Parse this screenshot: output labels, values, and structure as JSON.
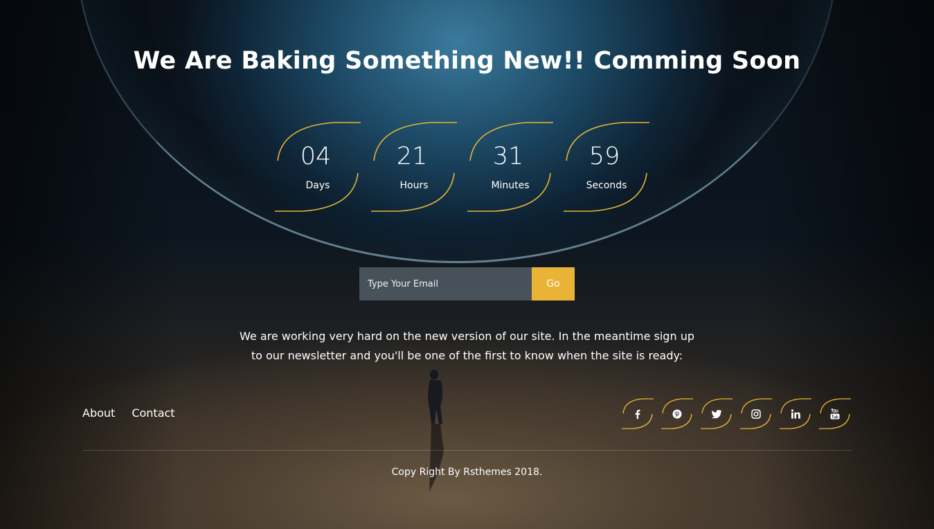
{
  "headline": "We Are Baking Something New!! Comming Soon",
  "countdown": [
    {
      "value": "04",
      "label": "Days"
    },
    {
      "value": "21",
      "label": "Hours"
    },
    {
      "value": "31",
      "label": "Minutes"
    },
    {
      "value": "59",
      "label": "Seconds"
    }
  ],
  "subscribe": {
    "placeholder": "Type Your Email",
    "button_label": "Go"
  },
  "description": "We are working very hard on the new version of our site. In the meantime sign up to our newsletter and you'll be one of the first to know when the site is ready:",
  "footer": {
    "links": [
      "About",
      "Contact"
    ],
    "social_icons": [
      "facebook-icon",
      "pinterest-icon",
      "twitter-icon",
      "instagram-icon",
      "linkedin-icon",
      "youtube-icon"
    ],
    "copyright": "Copy Right By Rsthemes 2018."
  },
  "colors": {
    "accent": "#e9b436",
    "input_bg": "#5a646e"
  }
}
